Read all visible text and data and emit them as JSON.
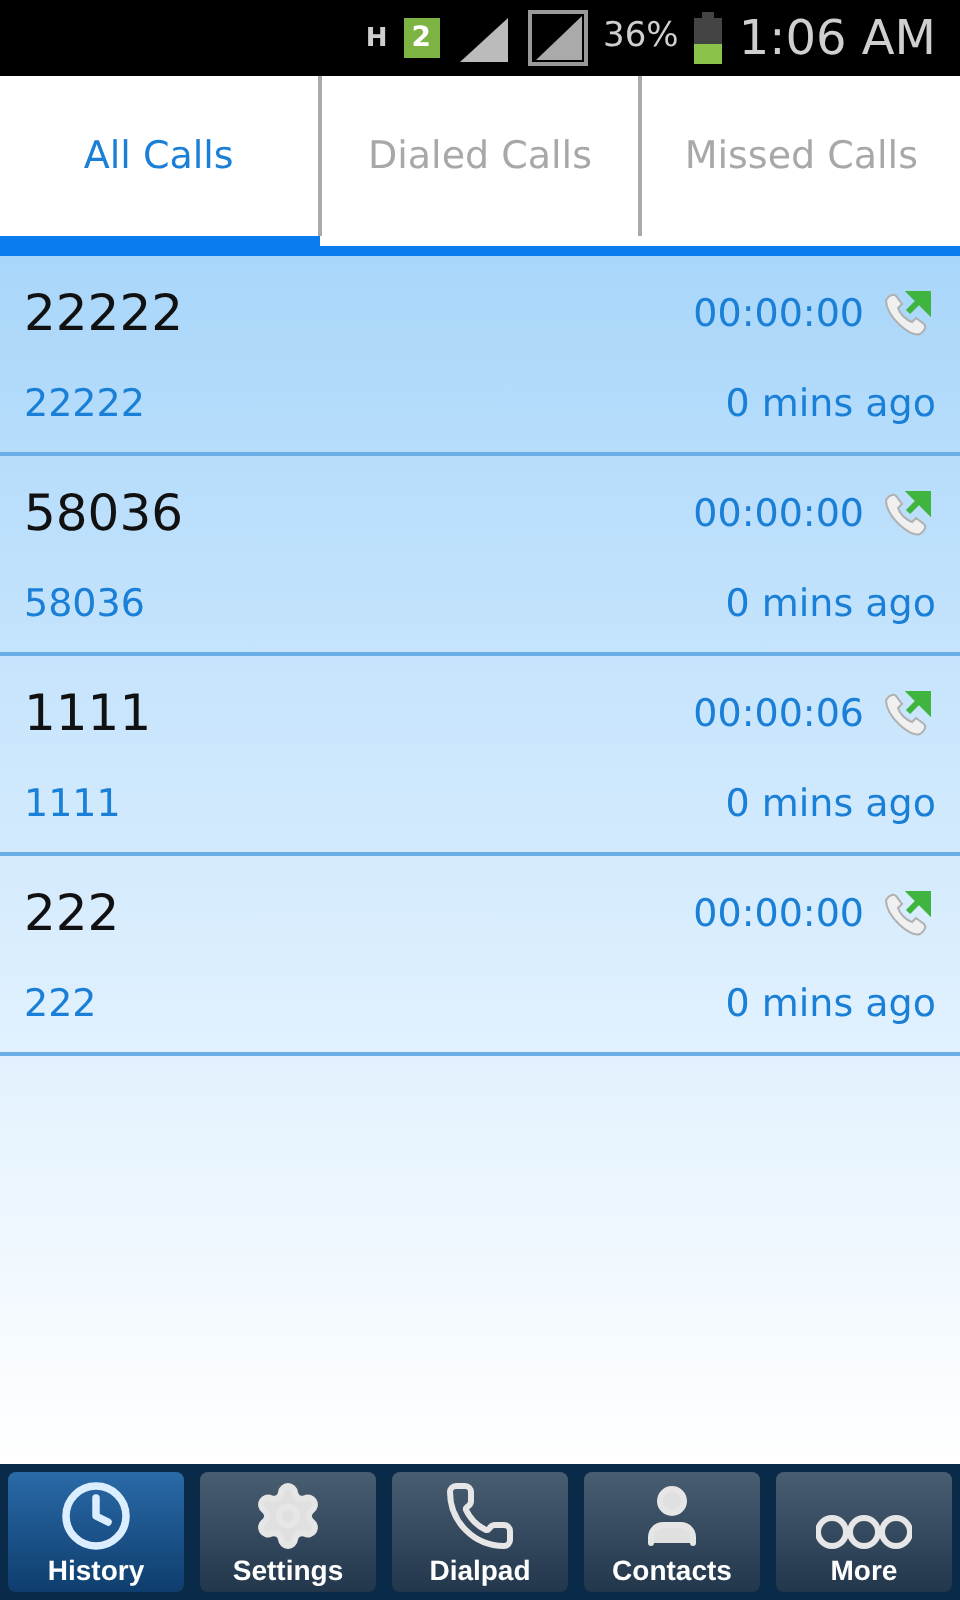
{
  "status_bar": {
    "network": "H",
    "sim": "2",
    "battery": "36%",
    "time": "1:06 AM"
  },
  "tabs": [
    {
      "label": "All Calls",
      "selected": true
    },
    {
      "label": "Dialed Calls",
      "selected": false
    },
    {
      "label": "Missed Calls",
      "selected": false
    }
  ],
  "calls": [
    {
      "name": "22222",
      "number": "22222",
      "duration": "00:00:00",
      "time": "0 mins ago"
    },
    {
      "name": "58036",
      "number": "58036",
      "duration": "00:00:00",
      "time": "0 mins ago"
    },
    {
      "name": "1111",
      "number": "1111",
      "duration": "00:00:06",
      "time": "0 mins ago"
    },
    {
      "name": "222",
      "number": "222",
      "duration": "00:00:00",
      "time": "0 mins ago"
    }
  ],
  "nav": [
    {
      "kind": "history",
      "label": "History",
      "selected": true
    },
    {
      "kind": "settings",
      "label": "Settings",
      "selected": false
    },
    {
      "kind": "dialpad",
      "label": "Dialpad",
      "selected": false
    },
    {
      "kind": "contacts",
      "label": "Contacts",
      "selected": false
    },
    {
      "kind": "more",
      "label": "More",
      "selected": false
    }
  ]
}
